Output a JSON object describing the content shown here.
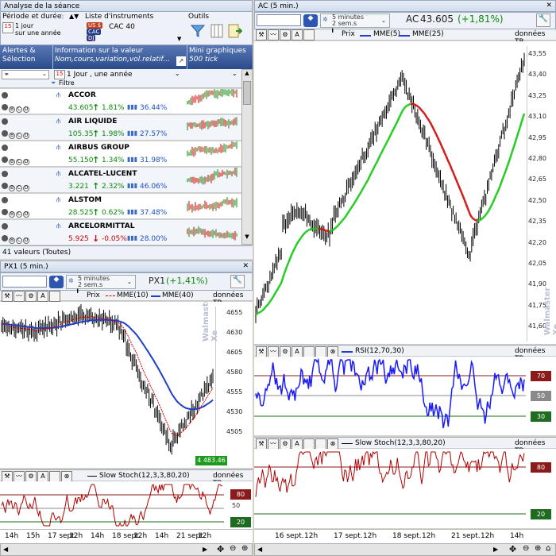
{
  "left_top": {
    "title": "Analyse de la séance",
    "filters": {
      "period_label": "Période et durée",
      "period_value_line1": "1 jour",
      "period_value_line2": "sur une année",
      "list_label": "Liste d'instruments",
      "list_chips": [
        "US $",
        "CAC",
        "DJ"
      ],
      "list_value": "CAC 40",
      "tools_label": "Outils"
    },
    "columns": {
      "alerts_line1": "Alertes &",
      "alerts_line2": "Sélection",
      "info_line1": "Information sur la valeur",
      "info_line2": "Nom,cours,variation,vol.relatif...",
      "mini_line1": "Mini graphiques",
      "mini_line2": "500 tick"
    },
    "subfilter": {
      "period": "1 Jour , une année",
      "filter_label": "Filtre"
    },
    "instruments": [
      {
        "name": "ACCOR",
        "price": "43.605",
        "change": "1.81%",
        "direction": "up",
        "vol": "36.44%"
      },
      {
        "name": "AIR LIQUIDE",
        "price": "105.35",
        "change": "1.98%",
        "direction": "up",
        "vol": "27.57%"
      },
      {
        "name": "AIRBUS GROUP",
        "price": "55.150",
        "change": "1.34%",
        "direction": "up",
        "vol": "31.98%"
      },
      {
        "name": "ALCATEL-LUCENT",
        "price": "3.221",
        "change": "2.32%",
        "direction": "up",
        "vol": "46.06%"
      },
      {
        "name": "ALSTOM",
        "price": "28.525",
        "change": "0.62%",
        "direction": "up",
        "vol": "37.48%"
      },
      {
        "name": "ARCELORMITTAL",
        "price": "5.925",
        "change": "-0.05%",
        "direction": "down",
        "vol": "28.00%"
      }
    ],
    "status": "41 valeurs (Toutes)"
  },
  "px1": {
    "title": "PX1 (5 min.)",
    "interval_line1": "5 minutes",
    "interval_line2": "2 sem.s",
    "symbol": "PX1",
    "change": "(+1,41%)",
    "legend_price": "Prix",
    "legend_mme10": "MME(10)",
    "legend_mme40": "MME(40)",
    "data_tag": "données TR",
    "yticks": [
      "4655",
      "4630",
      "4605",
      "4580",
      "4555",
      "4530",
      "4505"
    ],
    "last_value": "4 483.46",
    "watermark": "Walmaster Xe",
    "stoch_label": "Slow Stoch(12,3,3,80,20)",
    "stoch_levels": [
      "80",
      "50",
      "20"
    ],
    "xticks": [
      "14h",
      "15h",
      "17 sept.",
      "12h",
      "14h",
      "18 sept.",
      "12h",
      "14h",
      "21 sept.",
      "12h"
    ]
  },
  "ac": {
    "title": "AC (5 min.)",
    "interval_line1": "5 minutes",
    "interval_line2": "2 sem.s",
    "symbol": "AC",
    "price": "43.605",
    "change": "(+1,81%)",
    "legend_price": "Prix",
    "legend_mme5": "MME(5)",
    "legend_mme25": "MME(25)",
    "data_tag": "données TR",
    "yticks": [
      "43,55",
      "43,40",
      "43,25",
      "43,10",
      "42,95",
      "42,80",
      "42,65",
      "42,50",
      "42,35",
      "42,20",
      "42,05",
      "41,90",
      "41,75",
      "41,60"
    ],
    "watermark": "Walmaster Xe",
    "rsi_label": "RSI(12,70,30)",
    "rsi_levels": [
      "70",
      "50",
      "30"
    ],
    "stoch_label": "Slow Stoch(12,3,3,80,20)",
    "stoch_levels": [
      "80",
      "20"
    ],
    "xticks": [
      "16 sept.",
      "12h",
      "17 sept.",
      "12h",
      "18 sept.",
      "12h",
      "21 sept.",
      "12h",
      "14h"
    ]
  },
  "colors": {
    "rising": "#0a8a0a",
    "falling": "#d40000",
    "ema_short": "#d40000",
    "ema_long": "#1f3fc8",
    "ema_up": "#22cc22",
    "ema_down": "#d41a1a",
    "rsi": "#1a1aff",
    "stoch": "#b00000",
    "level_red": "#8b1a1a",
    "level_grey": "#8a8a8a",
    "level_green": "#1f6b1f",
    "last_value_bg": "#1e9a1e"
  }
}
